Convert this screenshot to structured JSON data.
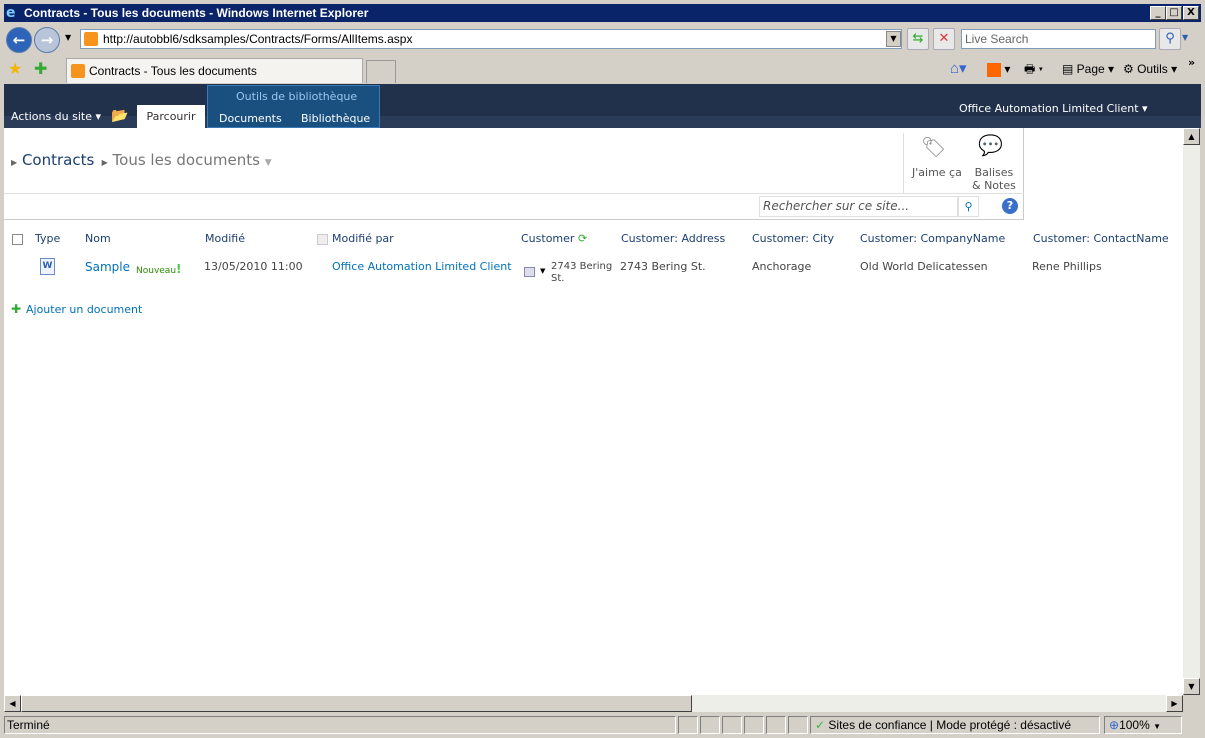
{
  "window": {
    "title": "Contracts - Tous les documents - Windows Internet Explorer",
    "min": "_",
    "max": "□",
    "close": "X"
  },
  "browser": {
    "url": "http://autobbl6/sdksamples/Contracts/Forms/AllItems.aspx",
    "search_placeholder": "Live Search",
    "tab_title": "Contracts - Tous les documents",
    "page_menu": "Page",
    "tools_menu": "Outils",
    "more": "»"
  },
  "ribbon": {
    "site_actions": "Actions du site",
    "tab_browse": "Parcourir",
    "group_title": "Outils de bibliothèque",
    "tab_documents": "Documents",
    "tab_library": "Bibliothèque",
    "user": "Office Automation Limited Client"
  },
  "breadcrumb": {
    "site": "Contracts",
    "view": "Tous les documents"
  },
  "social": {
    "like": "J'aime ça",
    "tags_line1": "Balises",
    "tags_line2": "& Notes"
  },
  "site_search": {
    "placeholder": "Rechercher sur ce site..."
  },
  "table": {
    "columns": [
      "Type",
      "Nom",
      "Modifié",
      "Modifié par",
      "Customer",
      "Customer: Address",
      "Customer: City",
      "Customer: CompanyName",
      "Customer: ContactName"
    ],
    "rows": [
      {
        "type_icon": "word-doc-icon",
        "name": "Sample",
        "badge": "Nouveau",
        "modified": "13/05/2010 11:00",
        "modified_by": "Office Automation Limited Client",
        "customer_line1": "2743 Bering",
        "customer_line2": "St.",
        "address": "2743 Bering St.",
        "city": "Anchorage",
        "company": "Old World Delicatessen",
        "contact": "Rene Phillips"
      }
    ]
  },
  "add_document": "Ajouter un document",
  "status": {
    "text": "Terminé",
    "zone": "Sites de confiance | Mode protégé : désactivé",
    "zoom": "100%"
  },
  "colors": {
    "titlebar": "#0a246a",
    "ribbon": "#21314b",
    "link": "#0072bc"
  }
}
